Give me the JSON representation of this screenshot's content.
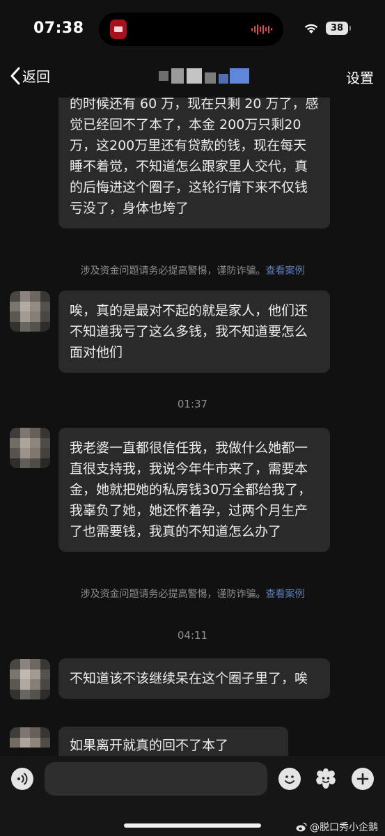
{
  "status_bar": {
    "time": "07:38",
    "battery": "38"
  },
  "nav": {
    "back_label": "返回",
    "settings_label": "设置"
  },
  "messages": [
    {
      "text": "的时候还有 60 万，现在只剩 20 万了，感觉已经回不了本了，本金 200万只剩20万，这200万里还有贷款的钱，现在每天睡不着觉，不知道怎么跟家里人交代，真的后悔进这个圈子，这轮行情下来不仅钱亏没了，身体也垮了"
    },
    {
      "text": "唉，真的是最对不起的就是家人，他们还不知道我亏了这么多钱，我不知道要怎么面对他们"
    },
    {
      "text": "我老婆一直都很信任我，我做什么她都一直很支持我，我说今年牛市来了，需要本金，她就把她的私房钱30万全都给我了，我辜负了她，她还怀着孕，过两个月生产了也需要钱，我真的不知道怎么办了"
    },
    {
      "text": "不知道该不该继续呆在这个圈子里了，唉"
    },
    {
      "text": "如果离开就真的回不了本了"
    }
  ],
  "warning": {
    "text": "涉及资金问题请务必提高警惕，谨防诈骗。",
    "link": "查看案例"
  },
  "timestamps": [
    "01:37",
    "04:11"
  ],
  "input": {
    "placeholder": ""
  },
  "watermark": "@脱口秀小企鹅",
  "colors": {
    "background": "#111111",
    "bubble": "#2a2a2a",
    "link": "#5f7fbf",
    "muted_text": "#8e8e8e"
  },
  "icons": [
    "wifi-icon",
    "chevron-left-icon",
    "voice-icon",
    "emoji-icon",
    "sticker-icon",
    "plus-icon",
    "weibo-icon"
  ]
}
